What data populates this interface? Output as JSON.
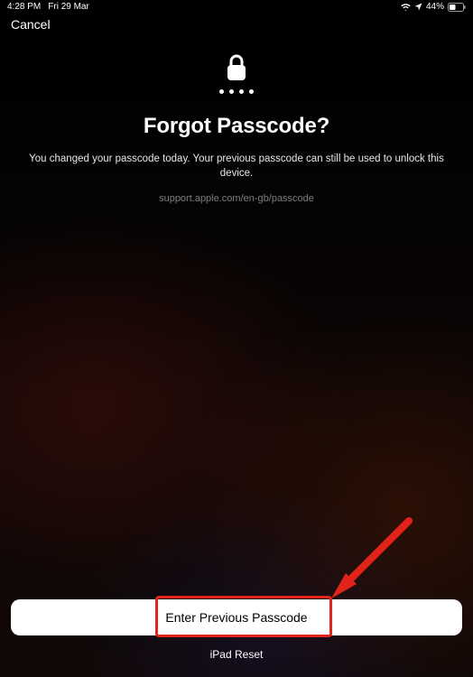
{
  "status": {
    "time": "4:28 PM",
    "date": "Fri 29 Mar",
    "battery_pct": "44%"
  },
  "nav": {
    "cancel": "Cancel"
  },
  "main": {
    "title": "Forgot Passcode?",
    "subtitle": "You changed your passcode today. Your previous passcode can still be used to unlock this device.",
    "support_url": "support.apple.com/en-gb/passcode"
  },
  "actions": {
    "primary": "Enter Previous Passcode",
    "secondary": "iPad Reset"
  }
}
